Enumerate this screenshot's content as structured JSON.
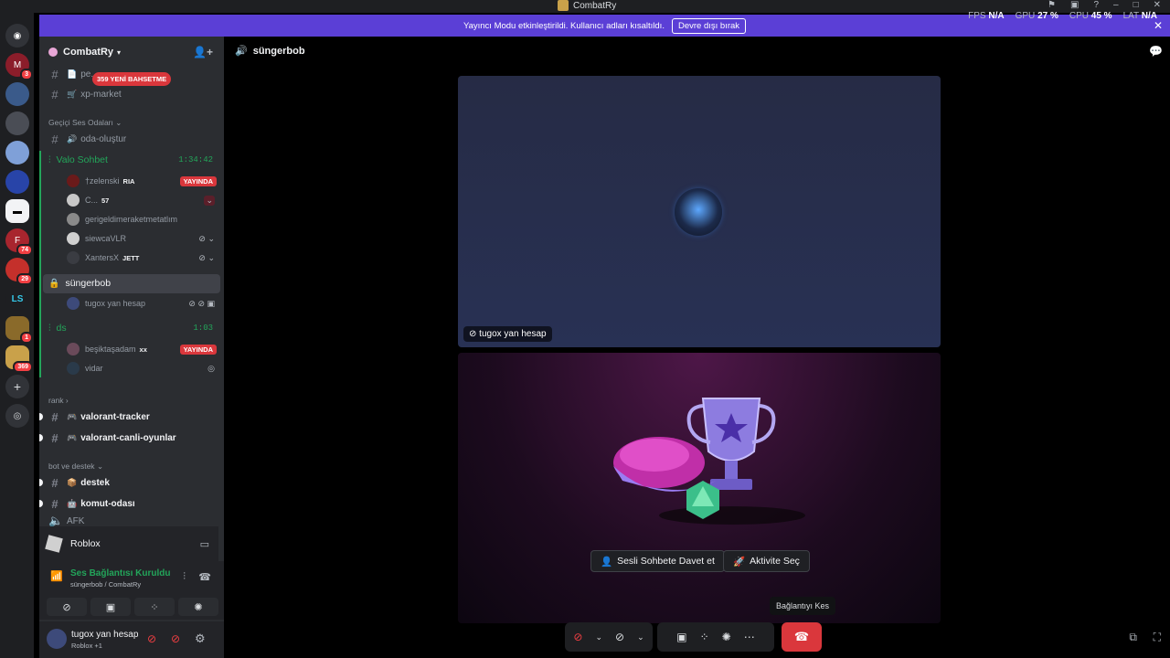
{
  "window": {
    "title": "CombatRy"
  },
  "banner": {
    "text": "Yayıncı Modu etkinleştirildi. Kullanıcı adları kısaltıldı.",
    "button": "Devre dışı bırak"
  },
  "perf": {
    "fps_label": "FPS",
    "fps": "N/A",
    "gpu_label": "GPU",
    "gpu": "27 %",
    "cpu_label": "CPU",
    "cpu": "45 %",
    "lat_label": "LAT",
    "lat": "N/A"
  },
  "rail": {
    "badges": [
      "3",
      "74",
      "29",
      "1",
      "369"
    ]
  },
  "server": {
    "name": "CombatRy"
  },
  "mention_badge": "359 YENİ BAHSETME",
  "channels": {
    "c1": "pe...",
    "c2": "xp-market",
    "cat1": "Geçiçi Ses Odaları",
    "c3": "oda-oluştur",
    "cat2": "rank",
    "c4": "valorant-tracker",
    "c5": "valorant-canli-oyunlar",
    "cat3": "bot ve destek",
    "c6": "destek",
    "c7": "komut-odası",
    "c8": "AFK"
  },
  "voice_channels": {
    "valo": {
      "name": "Valo Sohbet",
      "time": "1:34:42"
    },
    "sunger": {
      "name": "süngerbob"
    },
    "ds": {
      "name": "ds",
      "time": "1:03"
    }
  },
  "members": {
    "m1": "†zelenski",
    "m1_tag": "RIA",
    "m1_live": "YAYINDA",
    "m2": "C...",
    "m2_tag": "57",
    "m3": "gerigeldimeraketmetatlım",
    "m4": "siewcaVLR",
    "m5": "XantersX",
    "m5_tag": "JETT",
    "m6": "tugox yan hesap",
    "m7": "beşiktaşadam",
    "m7_tag": "xx",
    "m7_live": "YAYINDA",
    "m8": "vidar"
  },
  "activity": {
    "name": "Roblox"
  },
  "voice_status": {
    "status": "Ses Bağlantısı Kuruldu",
    "location": "süngerbob / CombatRy"
  },
  "user": {
    "name": "tugox yan hesap",
    "activity": "Roblox +1"
  },
  "main": {
    "channel": "süngerbob",
    "tile_label": "tugox yan hesap",
    "invite_button": "Sesli Sohbete Davet et",
    "activity_button": "Aktivite Seç",
    "tooltip": "Bağlantıyı Kes"
  }
}
